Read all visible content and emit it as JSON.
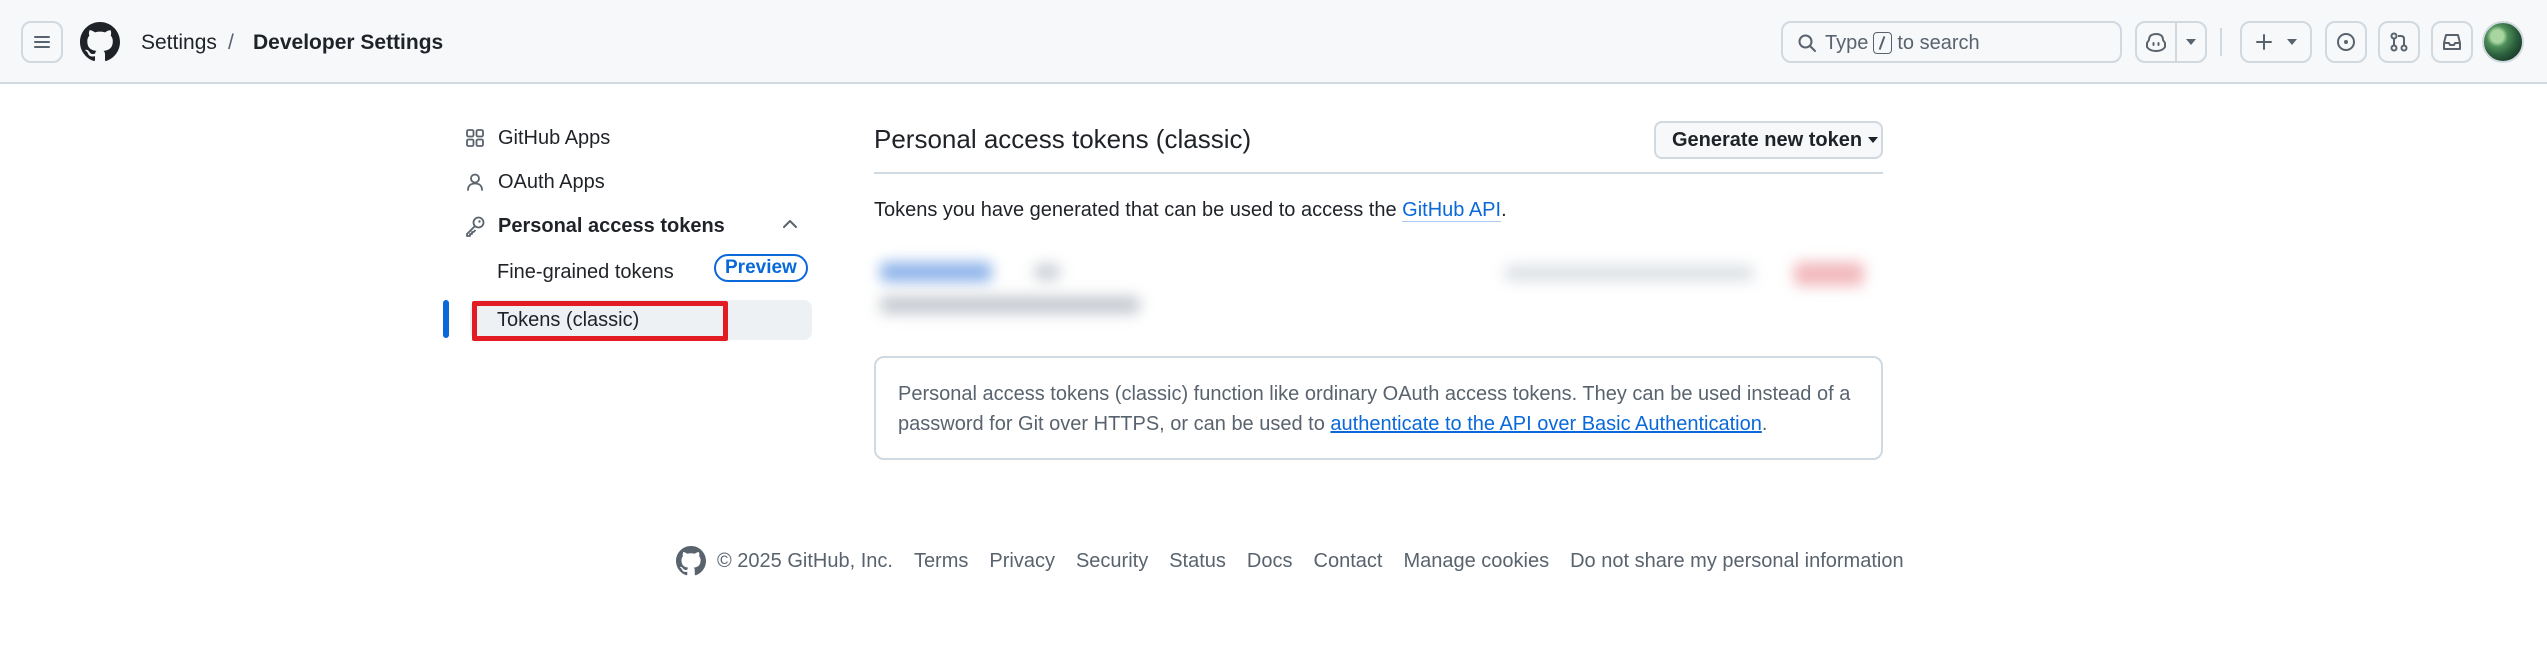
{
  "header": {
    "breadcrumb": [
      "Settings",
      "/",
      "Developer Settings"
    ],
    "search_placeholder_before": "Type",
    "search_placeholder_after": "to search"
  },
  "sidebar": {
    "items": [
      {
        "label": "GitHub Apps",
        "icon": "apps-grid-icon"
      },
      {
        "label": "OAuth Apps",
        "icon": "person-icon"
      },
      {
        "label": "Personal access tokens",
        "icon": "key-icon",
        "expanded": true
      }
    ],
    "sub_items": [
      {
        "label": "Fine-grained tokens",
        "badge": "Preview"
      },
      {
        "label": "Tokens (classic)",
        "active": true
      }
    ]
  },
  "main": {
    "title": "Personal access tokens (classic)",
    "generate_button": "Generate new token",
    "description_prefix": "Tokens you have generated that can be used to access the",
    "description_link": "GitHub API",
    "description_suffix": ".",
    "note_text": "Personal access tokens (classic) function like ordinary OAuth access tokens. They can be used instead of a password for Git over HTTPS, or can be used to",
    "note_link": "authenticate to the API over Basic Authentication",
    "note_suffix": "."
  },
  "footer": {
    "copyright": "© 2025 GitHub, Inc.",
    "links": [
      "Terms",
      "Privacy",
      "Security",
      "Status",
      "Docs",
      "Contact",
      "Manage cookies",
      "Do not share my personal information"
    ]
  },
  "colors": {
    "link": "#0969da",
    "highlight_box": "#e31b23",
    "active_indicator": "#0969da"
  }
}
